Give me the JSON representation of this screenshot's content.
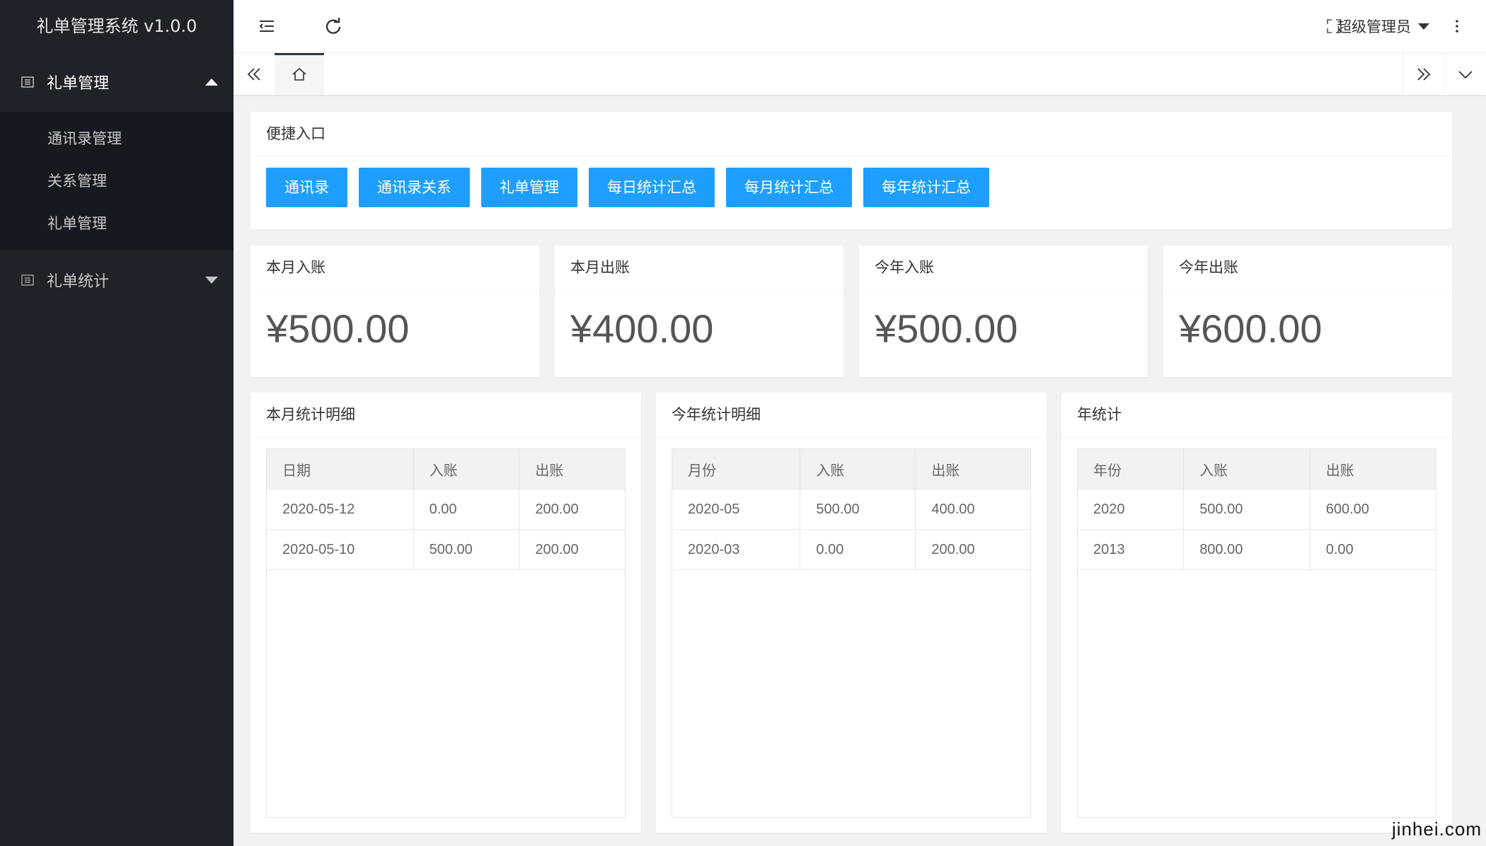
{
  "app": {
    "title": "礼单管理系统 v1.0.0"
  },
  "sidebar": {
    "groups": [
      {
        "label": "礼单管理",
        "open": true,
        "items": [
          "通讯录管理",
          "关系管理",
          "礼单管理"
        ]
      },
      {
        "label": "礼单统计",
        "open": false,
        "items": []
      }
    ]
  },
  "topbar": {
    "user": "超级管理员"
  },
  "quick": {
    "title": "便捷入口",
    "buttons": [
      "通讯录",
      "通讯录关系",
      "礼单管理",
      "每日统计汇总",
      "每月统计汇总",
      "每年统计汇总"
    ]
  },
  "stats": [
    {
      "label": "本月入账",
      "value": "¥500.00"
    },
    {
      "label": "本月出账",
      "value": "¥400.00"
    },
    {
      "label": "今年入账",
      "value": "¥500.00"
    },
    {
      "label": "今年出账",
      "value": "¥600.00"
    }
  ],
  "tables": [
    {
      "title": "本月统计明细",
      "headers": [
        "日期",
        "入账",
        "出账"
      ],
      "rows": [
        [
          "2020-05-12",
          "0.00",
          "200.00"
        ],
        [
          "2020-05-10",
          "500.00",
          "200.00"
        ]
      ]
    },
    {
      "title": "今年统计明细",
      "headers": [
        "月份",
        "入账",
        "出账"
      ],
      "rows": [
        [
          "2020-05",
          "500.00",
          "400.00"
        ],
        [
          "2020-03",
          "0.00",
          "200.00"
        ]
      ]
    },
    {
      "title": "年统计",
      "headers": [
        "年份",
        "入账",
        "出账"
      ],
      "rows": [
        [
          "2020",
          "500.00",
          "600.00"
        ],
        [
          "2013",
          "800.00",
          "0.00"
        ]
      ]
    }
  ],
  "watermark": "jinhei.com",
  "colors": {
    "sidebar_bg": "#20222a",
    "submenu_bg": "#161a20",
    "primary_button": "#1e9fff",
    "page_bg": "#f2f2f2"
  }
}
